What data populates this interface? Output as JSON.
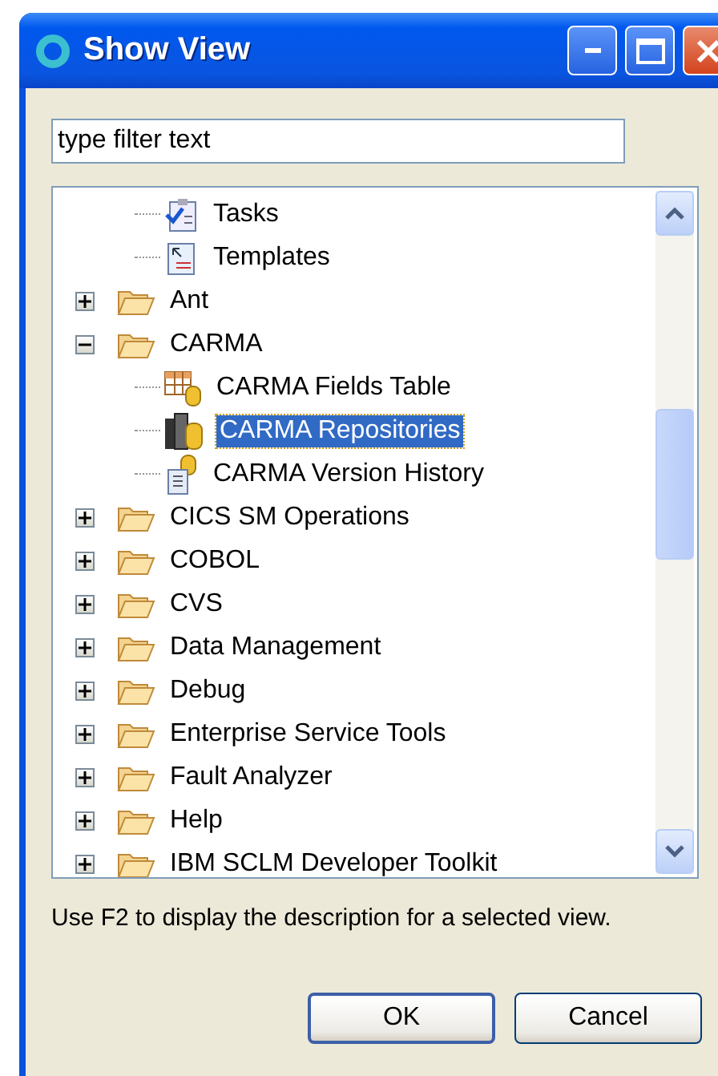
{
  "window": {
    "title": "Show View"
  },
  "filter": {
    "placeholder": "type filter text"
  },
  "tree": {
    "continued_children": [
      {
        "label": "Tasks",
        "kind": "tasks",
        "selected": false
      },
      {
        "label": "Templates",
        "kind": "templates",
        "selected": false
      }
    ],
    "items": [
      {
        "label": "Ant",
        "kind": "folder",
        "expanded": false,
        "selected": false
      },
      {
        "label": "CARMA",
        "kind": "folder",
        "expanded": true,
        "selected": false,
        "children": [
          {
            "label": "CARMA Fields Table",
            "kind": "table",
            "selected": false
          },
          {
            "label": "CARMA Repositories",
            "kind": "repository",
            "selected": true
          },
          {
            "label": "CARMA Version History",
            "kind": "history",
            "selected": false
          }
        ]
      },
      {
        "label": "CICS SM Operations",
        "kind": "folder",
        "expanded": false,
        "selected": false
      },
      {
        "label": "COBOL",
        "kind": "folder",
        "expanded": false,
        "selected": false
      },
      {
        "label": "CVS",
        "kind": "folder",
        "expanded": false,
        "selected": false
      },
      {
        "label": "Data Management",
        "kind": "folder",
        "expanded": false,
        "selected": false
      },
      {
        "label": "Debug",
        "kind": "folder",
        "expanded": false,
        "selected": false
      },
      {
        "label": "Enterprise Service Tools",
        "kind": "folder",
        "expanded": false,
        "selected": false
      },
      {
        "label": "Fault Analyzer",
        "kind": "folder",
        "expanded": false,
        "selected": false
      },
      {
        "label": "Help",
        "kind": "folder",
        "expanded": false,
        "selected": false
      },
      {
        "label": "IBM SCLM Developer Toolkit",
        "kind": "folder",
        "expanded": false,
        "selected": false
      }
    ]
  },
  "hint": "Use F2 to display the description for a selected view.",
  "buttons": [
    {
      "label": "OK",
      "default": true
    },
    {
      "label": "Cancel",
      "default": false
    }
  ]
}
